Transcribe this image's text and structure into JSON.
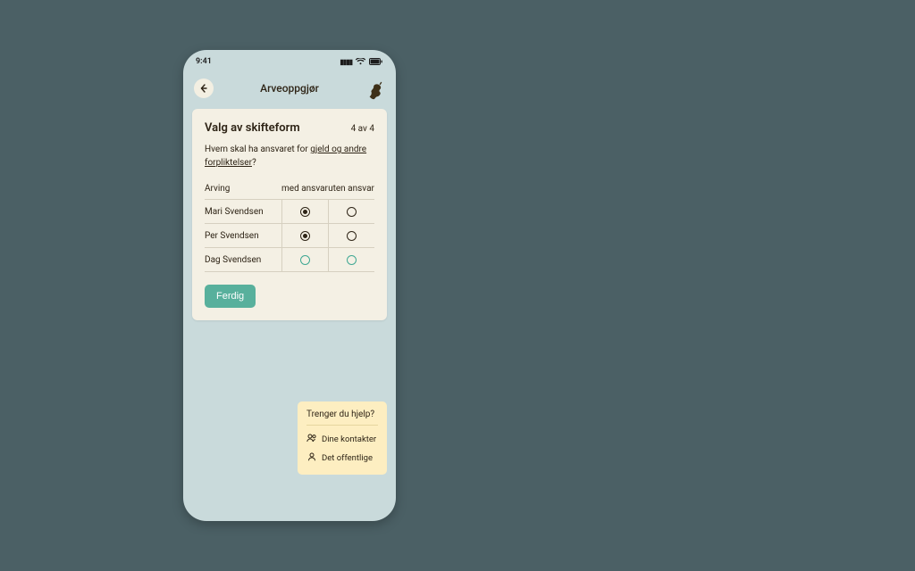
{
  "statusbar": {
    "time": "9:41"
  },
  "header": {
    "title": "Arveoppgjør"
  },
  "card": {
    "title": "Valg av skifteform",
    "step": "4 av 4",
    "question_prefix": "Hvem skal ha ansvaret for ",
    "question_link": "gjeld og andre forpliktelser",
    "question_suffix": "?",
    "columns": {
      "name": "Arving",
      "with": "med ansvar",
      "without": "uten ansvar"
    },
    "rows": [
      {
        "name": "Mari Svendsen",
        "selected": "with",
        "accent": false
      },
      {
        "name": "Per Svendsen",
        "selected": "with",
        "accent": false
      },
      {
        "name": "Dag Svendsen",
        "selected": null,
        "accent": true
      }
    ],
    "done_label": "Ferdig"
  },
  "help": {
    "title": "Trenger du hjelp?",
    "items": [
      {
        "icon": "people",
        "label": "Dine kontakter"
      },
      {
        "icon": "person",
        "label": "Det offentlige"
      }
    ]
  }
}
